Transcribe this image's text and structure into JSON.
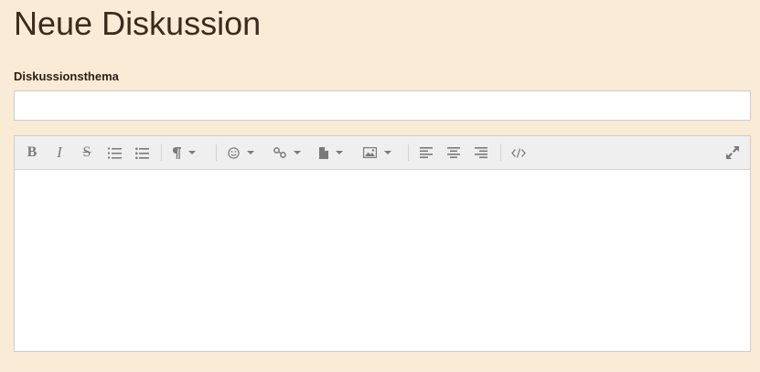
{
  "page": {
    "title": "Neue Diskussion"
  },
  "form": {
    "topic_label": "Diskussionsthema",
    "topic_value": "",
    "topic_placeholder": ""
  },
  "editor": {
    "content": "",
    "toolbar": [
      {
        "name": "bold-icon",
        "glyph": "B"
      },
      {
        "name": "italic-icon",
        "glyph": "I"
      },
      {
        "name": "strikethrough-icon",
        "glyph": "S"
      },
      {
        "name": "ordered-list-icon"
      },
      {
        "name": "unordered-list-icon"
      },
      {
        "name": "paragraph-format-icon",
        "dropdown": true
      },
      {
        "name": "emoticon-icon",
        "dropdown": true
      },
      {
        "name": "link-icon",
        "dropdown": true
      },
      {
        "name": "file-icon",
        "dropdown": true
      },
      {
        "name": "image-icon",
        "dropdown": true
      },
      {
        "name": "align-left-icon"
      },
      {
        "name": "align-center-icon"
      },
      {
        "name": "align-right-icon"
      },
      {
        "name": "code-view-icon"
      },
      {
        "name": "fullscreen-icon"
      }
    ]
  },
  "colors": {
    "background": "#faebd7",
    "toolbar": "#efefef",
    "icon": "#7a7a7a"
  }
}
